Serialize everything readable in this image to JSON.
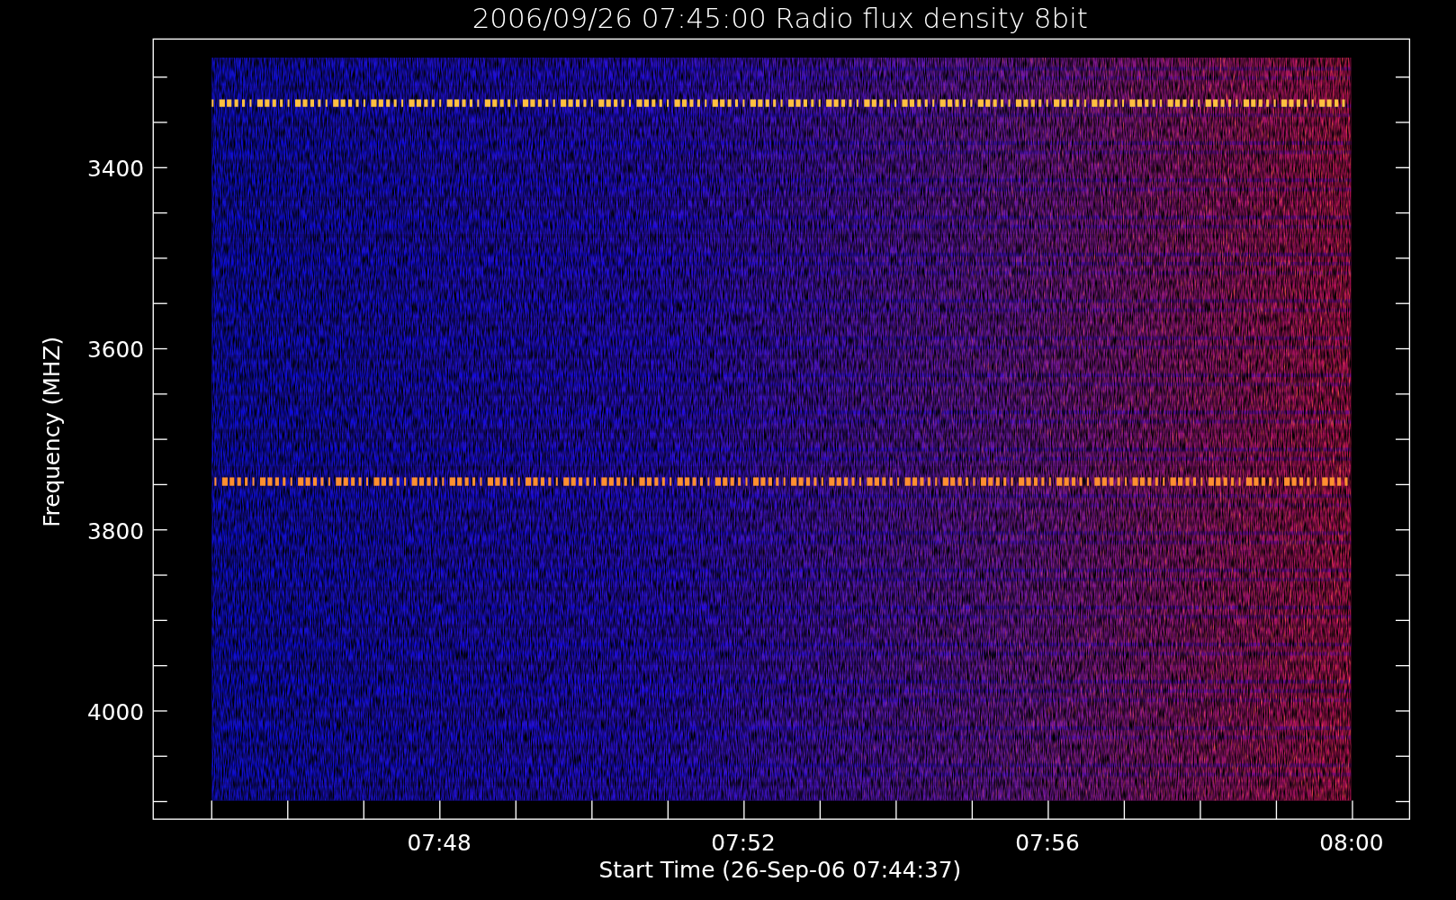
{
  "title": "2006/09/26 07:45:00 Radio flux density 8bit",
  "y_axis": {
    "label": "Frequency (MHZ)",
    "ticks": [
      "3400",
      "3600",
      "3800",
      "4000"
    ]
  },
  "x_axis": {
    "label": "Start Time (26-Sep-06 07:44:37)",
    "ticks": [
      "07:48",
      "07:52",
      "07:56",
      "08:00"
    ]
  }
}
